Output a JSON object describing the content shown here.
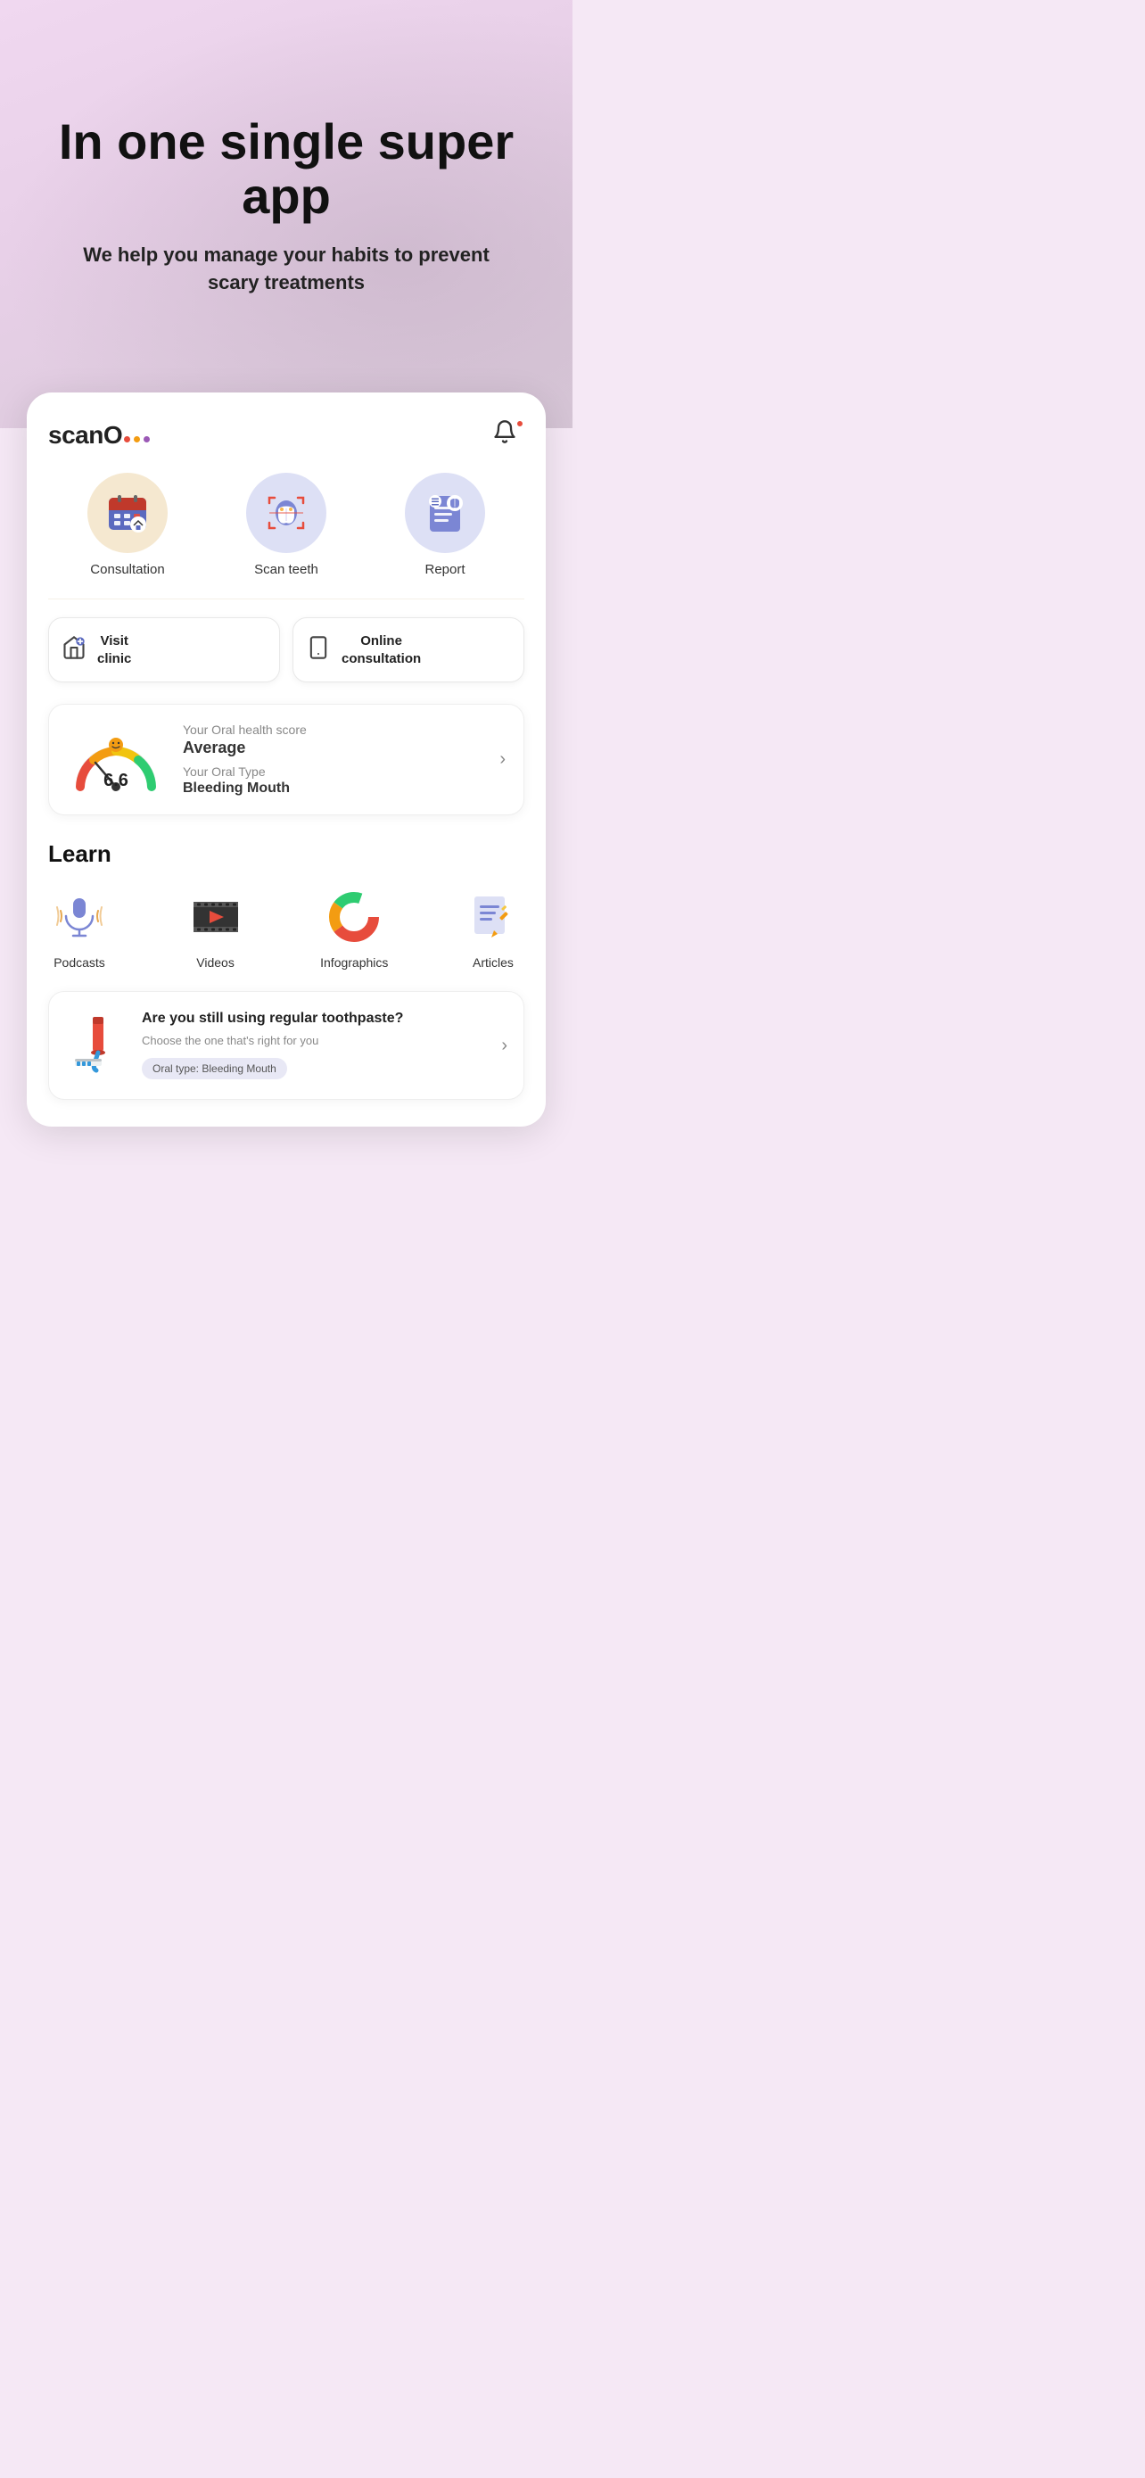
{
  "hero": {
    "title": "In one single super app",
    "subtitle": "We help you manage your habits to prevent scary treatments"
  },
  "app": {
    "logo_text": "scan",
    "logo_o": "O",
    "logo_dots": [
      {
        "color": "#e74c3c"
      },
      {
        "color": "#f39c12"
      },
      {
        "color": "#9b59b6"
      }
    ],
    "notification_dot": true
  },
  "actions": [
    {
      "id": "consultation",
      "label": "Consultation",
      "bg": "consultation"
    },
    {
      "id": "scan",
      "label": "Scan teeth",
      "bg": "scan"
    },
    {
      "id": "report",
      "label": "Report",
      "bg": "report"
    }
  ],
  "visit_buttons": [
    {
      "id": "visit-clinic",
      "label": "Visit\nclinic",
      "icon": "🏠"
    },
    {
      "id": "online-consultation",
      "label": "Online\nconsultation",
      "icon": "📱"
    }
  ],
  "oral_health": {
    "score_label": "Your Oral health score",
    "score_value": "Average",
    "type_label": "Your Oral Type",
    "type_value": "Bleeding Mouth",
    "score_number": "6.6"
  },
  "learn": {
    "section_title": "Learn",
    "items": [
      {
        "id": "podcasts",
        "label": "Podcasts"
      },
      {
        "id": "videos",
        "label": "Videos"
      },
      {
        "id": "infographics",
        "label": "Infographics"
      },
      {
        "id": "articles",
        "label": "Articles"
      }
    ]
  },
  "article": {
    "title": "Are you still using regular toothpaste?",
    "subtitle": "Choose the one that's right for you",
    "tag": "Oral type: Bleeding Mouth"
  }
}
